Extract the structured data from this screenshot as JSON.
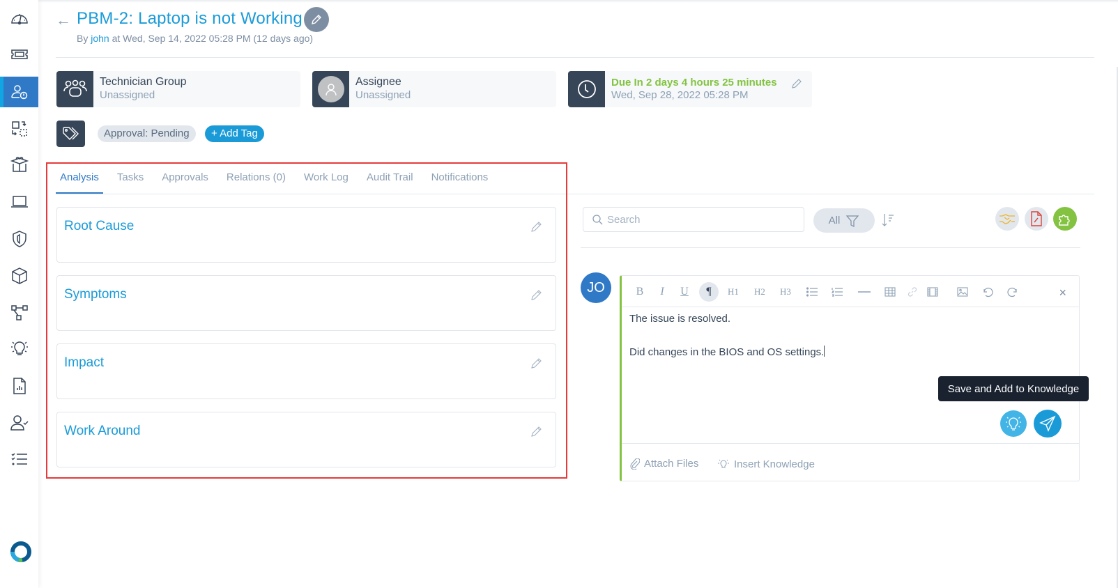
{
  "header": {
    "title": "PBM-2: Laptop is not Working",
    "by_prefix": "By",
    "author": "john",
    "created_suffix": "at Wed, Sep 14, 2022 05:28 PM (12 days ago)"
  },
  "sidebar": {
    "items": [
      {
        "name": "dashboard",
        "icon": "speedometer-icon"
      },
      {
        "name": "requests",
        "icon": "ticket-icon"
      },
      {
        "name": "problems",
        "icon": "user-alert-icon",
        "active": true
      },
      {
        "name": "changes",
        "icon": "change-icon"
      },
      {
        "name": "releases",
        "icon": "gift-box-icon"
      },
      {
        "name": "assets",
        "icon": "laptop-icon"
      },
      {
        "name": "security",
        "icon": "shield-icon"
      },
      {
        "name": "cmdb",
        "icon": "cube-icon"
      },
      {
        "name": "workflow",
        "icon": "flow-icon"
      },
      {
        "name": "knowledge",
        "icon": "bulb-icon"
      },
      {
        "name": "reports",
        "icon": "report-icon"
      },
      {
        "name": "approvals",
        "icon": "user-check-icon"
      },
      {
        "name": "tasks",
        "icon": "checklist-icon"
      }
    ]
  },
  "info_cards": {
    "technician_group": {
      "label": "Technician Group",
      "value": "Unassigned"
    },
    "assignee": {
      "label": "Assignee",
      "value": "Unassigned"
    },
    "due": {
      "label": "Due In 2 days 4 hours 25 minutes",
      "value": "Wed, Sep 28, 2022 05:28 PM"
    }
  },
  "tags": {
    "items": [
      "Approval: Pending"
    ],
    "add_label": "+ Add Tag"
  },
  "tabs": [
    {
      "label": "Analysis",
      "active": true
    },
    {
      "label": "Tasks"
    },
    {
      "label": "Approvals"
    },
    {
      "label": "Relations (0)"
    },
    {
      "label": "Work Log"
    },
    {
      "label": "Audit Trail"
    },
    {
      "label": "Notifications"
    }
  ],
  "analysis_sections": [
    {
      "title": "Root Cause"
    },
    {
      "title": "Symptoms"
    },
    {
      "title": "Impact"
    },
    {
      "title": "Work Around"
    }
  ],
  "right_panel": {
    "search_placeholder": "Search",
    "filter_label": "All",
    "avatar_initials": "JO",
    "editor": {
      "toolbar": [
        "B",
        "I",
        "U",
        "¶",
        "H1",
        "H2",
        "H3"
      ],
      "lines": [
        "The issue is resolved.",
        "",
        "Did changes in the BIOS and OS settings."
      ],
      "close": "×",
      "attach_label": "Attach Files",
      "insert_knowledge_label": "Insert Knowledge"
    },
    "tooltip": "Save and Add to Knowledge"
  },
  "colors": {
    "brand_blue": "#1a9bd8",
    "active_blue": "#3079c6",
    "dark": "#364658",
    "due_green": "#83c341",
    "highlight_red": "#e53b3b"
  }
}
